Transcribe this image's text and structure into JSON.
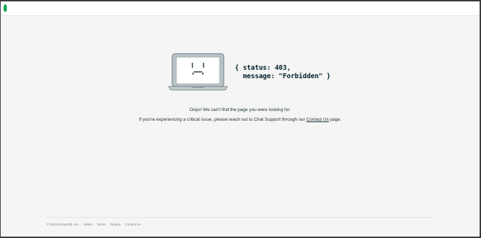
{
  "error": {
    "code_block": "{ status: 403,\n  message: \"Forbidden\" }"
  },
  "message": {
    "line1": "Oops! We can't find the page you were looking for.",
    "line2_before": "If you're experiencing a critical issue, please reach out to Chat Support through our ",
    "contact_link": "Contact Us",
    "line2_after": " page."
  },
  "footer": {
    "copyright": "© 2024 MongoDB, Inc.",
    "links": [
      "Status",
      "Terms",
      "Privacy",
      "Contact Us"
    ]
  },
  "colors": {
    "brand_green": "#13aa52",
    "background": "#f4f5f4",
    "laptop_frame": "#89979b",
    "laptop_screen": "#ffffff"
  },
  "icons": [
    "mongodb-leaf-icon",
    "sad-laptop-icon"
  ]
}
